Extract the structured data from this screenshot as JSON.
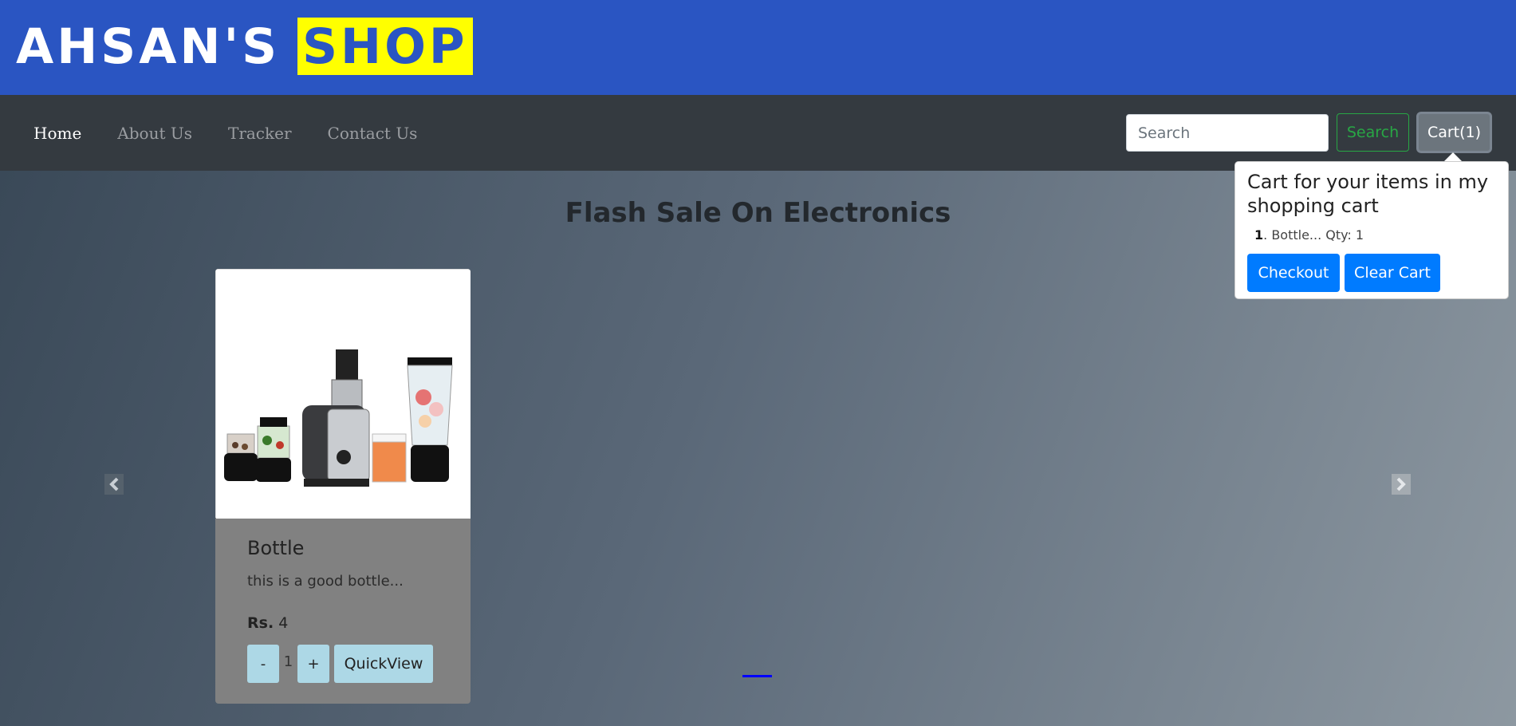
{
  "brand": {
    "name": "AHSAN'S",
    "highlight": "SHOP"
  },
  "nav": {
    "items": [
      {
        "label": "Home",
        "active": true
      },
      {
        "label": "About Us",
        "active": false
      },
      {
        "label": "Tracker",
        "active": false
      },
      {
        "label": "Contact Us",
        "active": false
      }
    ]
  },
  "search": {
    "placeholder": "Search",
    "button_label": "Search"
  },
  "cart": {
    "button_label": "Cart(1)",
    "popover_title": "Cart for your items in my shopping cart",
    "items": [
      {
        "index": "1",
        "text": ". Bottle... Qty: 1"
      }
    ],
    "checkout_label": "Checkout",
    "clear_label": "Clear Cart"
  },
  "section": {
    "title": "Flash Sale On Electronics"
  },
  "products": [
    {
      "name": "Bottle",
      "description": "this is a good bottle...",
      "price_prefix": "Rs.",
      "price": "4",
      "qty": "1",
      "minus_label": "-",
      "plus_label": "+",
      "quickview_label": "QuickView"
    }
  ],
  "colors": {
    "topbar": "#2a55c2",
    "brand_highlight_bg": "#ffff00",
    "navbar": "#343a40",
    "search_btn": "#28a745",
    "cart_btn": "#6c757d",
    "primary_btn": "#007bff",
    "qty_btn": "#add8e6"
  },
  "icons": {
    "prev": "chevron-left-icon",
    "next": "chevron-right-icon"
  }
}
